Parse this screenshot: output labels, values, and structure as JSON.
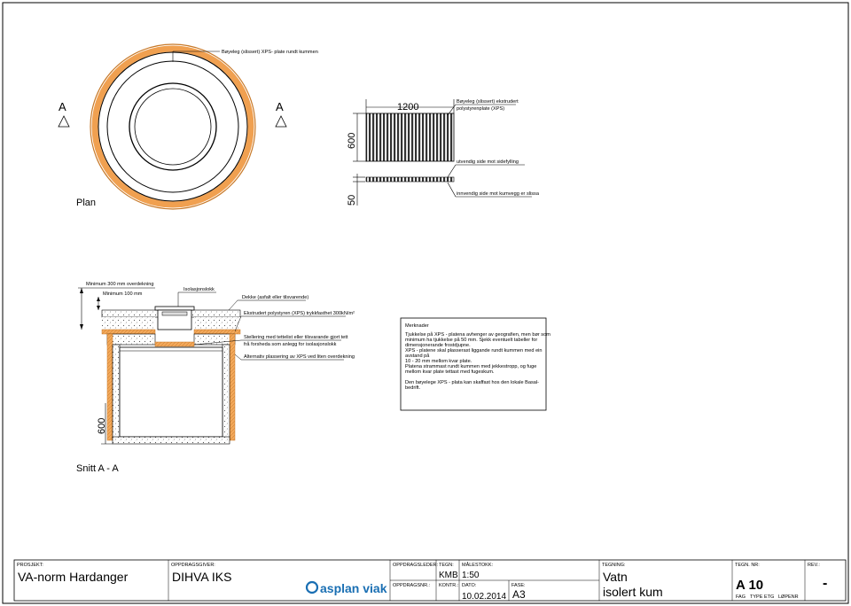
{
  "plan": {
    "title": "Plan",
    "section_marker_left": "A",
    "section_marker_right": "A",
    "callout_ring": "Bøyeleg (slissert) XPS- plate rundt kummen"
  },
  "detail": {
    "dim_width": "1200",
    "dim_height": "600",
    "dim_thickness": "50",
    "callout_plate": "Bøyeleg (slissert) ekstrudert polystyrenplate (XPS)",
    "callout_outer": "utvendig side mot sidefylling",
    "callout_inner": "innvendig side mot kumvegg er slissa"
  },
  "section": {
    "title": "Snitt A - A",
    "dim_depth": "600",
    "callout_min300": "Minimum 300 mm overdekning",
    "callout_min100": "Minimum 100 mm",
    "callout_isolation": "Isolasjonslokk",
    "callout_lid": "Dekke (asfalt eller tilsvarende)",
    "callout_xps": "Ekstrudert polystyren (XPS) trykkfasthet 300kN/m²",
    "callout_adjust_1": "Stellering med tettelist eller tilsvarande gjort tett",
    "callout_adjust_2": "frå forsheda som anlegg for isolasjonslokk",
    "callout_alt": "Alternativ plassering av XPS ved liten overdekning"
  },
  "notes": {
    "heading": "Merknader",
    "lines": [
      "Tjukkelse på XPS - platena avhenger av geografien, men bør som",
      "minimum ha tjukkelse på 50 mm. Sjekk eventuelt tabeller for",
      "dimensjonerande frostdjupne.",
      "XPS - platene skal plasserast liggande rundt kummen med ein",
      "avstand på",
      "10 - 20 mm mellom kvar plate.",
      "Platena strammast rundt kummen med jekkestropp, og fuge",
      "mellom kvar plate tettast med fugeskum.",
      "Den bøyelege XPS - plata kan skaffast hos den lokale Basal-",
      "bedrift."
    ]
  },
  "title_block": {
    "prosjekt_label": "PROSJEKT:",
    "prosjekt": "VA-norm Hardanger",
    "oppdragsgiver_label": "OPPDRAGSGIVER:",
    "oppdragsgiver": "DIHVA IKS",
    "logo_text": "asplan viak",
    "oppdragsleder_label": "OPPDRAGSLEDER:",
    "oppdragsnr_label": "OPPDRAGSNR.:",
    "tegn_label": "TEGN:",
    "tegn": "KMB",
    "kontr_label": "KONTR.:",
    "malestokk_label": "MÅLESTOKK:",
    "malestokk": "1:50",
    "dato_label": "DATO:",
    "dato": "10.02.2014",
    "fase_label": "FASE:",
    "fase": "A3",
    "tegning_label": "TEGNING:",
    "tegning_1": "Vatn",
    "tegning_2": "isolert kum",
    "tegn_nr_label": "TEGN. NR:",
    "tegn_nr": "A 10",
    "rev_label": "REV.:",
    "rev": "-",
    "fag_label": "FAG",
    "type_label": "TYPE",
    "etg_label": "ETG",
    "lopenr_label": "LØPENR"
  },
  "colors": {
    "insulation": "#f0a050",
    "insulation_dark": "#c87a2a",
    "line": "#000000",
    "concrete": "#d8d8d8"
  }
}
